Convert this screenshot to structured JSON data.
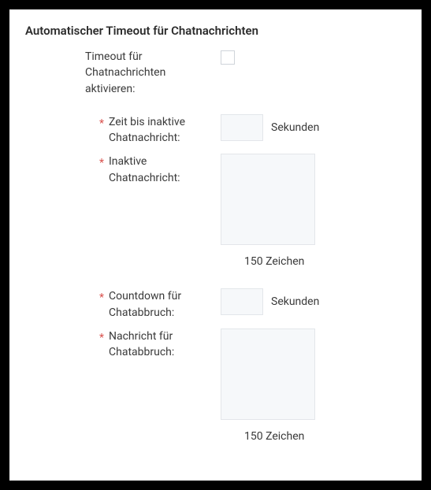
{
  "section": {
    "title": "Automatischer Timeout für Chatnachrichten"
  },
  "fields": {
    "enable": {
      "label": "Timeout für Chatnachrichten aktivieren:"
    },
    "inactive_time": {
      "label": "Zeit bis inaktive Chatnachricht:",
      "unit": "Sekunden",
      "value": ""
    },
    "inactive_message": {
      "label": "Inaktive Chatnachricht:",
      "value": "",
      "counter": "150 Zeichen"
    },
    "countdown": {
      "label": "Countdown für Chatabbruch:",
      "unit": "Sekunden",
      "value": ""
    },
    "abort_message": {
      "label": "Nachricht für Chatabbruch:",
      "value": "",
      "counter": "150 Zeichen"
    }
  }
}
